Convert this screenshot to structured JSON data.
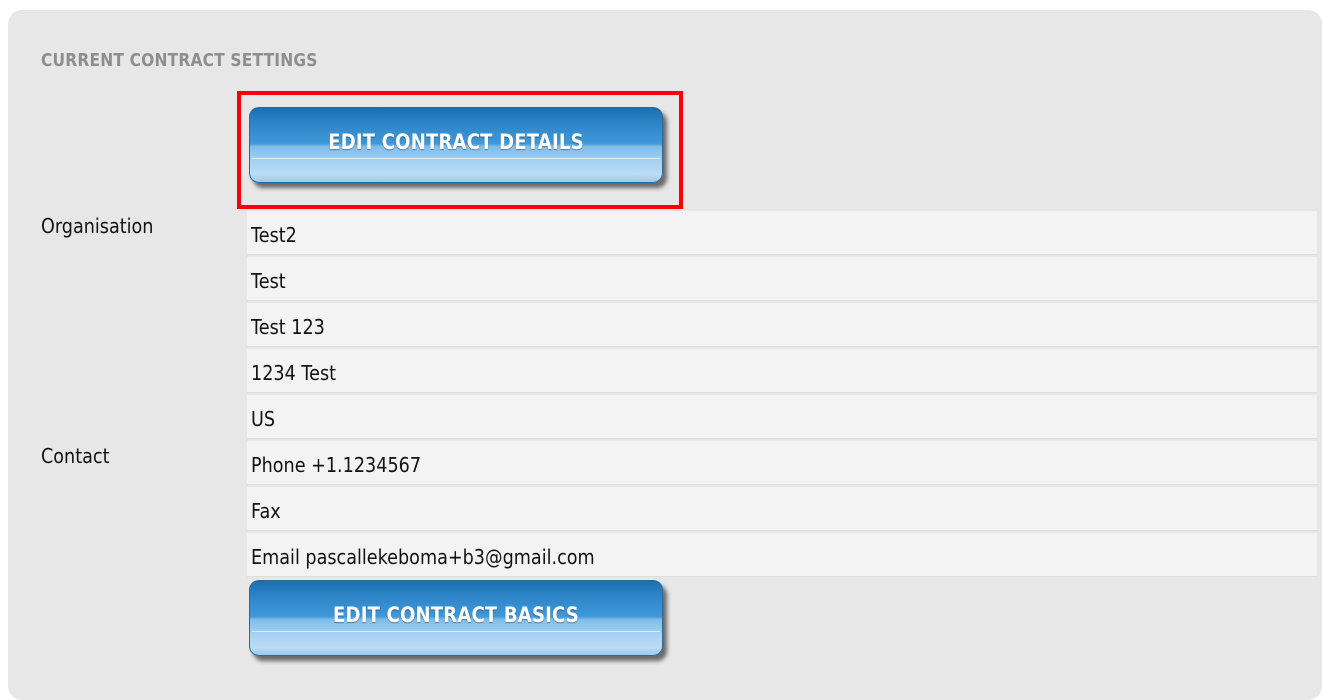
{
  "section": {
    "title": "CURRENT CONTRACT SETTINGS"
  },
  "buttons": {
    "edit_details": "EDIT CONTRACT DETAILS",
    "edit_basics": "EDIT CONTRACT BASICS"
  },
  "labels": {
    "organisation": "Organisation",
    "contact": "Contact"
  },
  "organisation": {
    "lines": [
      "Test2",
      "Test",
      "Test 123",
      "1234 Test",
      "US"
    ]
  },
  "contact": {
    "lines": [
      "Phone +1.1234567",
      "Fax",
      "Email pascallekeboma+b3@gmail.com"
    ]
  },
  "colors": {
    "panel_bg": "#e7e7e7",
    "highlight": "#ff0000",
    "button_top": "#1b6fb0",
    "button_bottom": "#b9dcf6"
  }
}
